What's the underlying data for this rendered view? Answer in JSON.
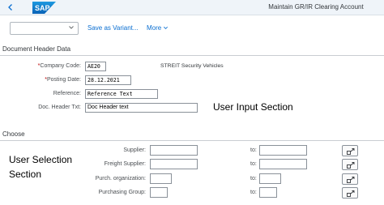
{
  "shell": {
    "logo_text": "SAP",
    "app_title": "Maintain GR/IR Clearing Account",
    "back_icon": "back-icon"
  },
  "toolbar": {
    "variant_value": "",
    "save_variant_label": "Save as Variant...",
    "more_label": "More"
  },
  "document_header": {
    "title": "Document Header Data",
    "company_code": {
      "label": "Company Code:",
      "value": "AE20",
      "description": "STREIT Security Vehicles"
    },
    "posting_date": {
      "label": "Posting Date:",
      "value": "28.12.2021"
    },
    "reference": {
      "label": "Reference:",
      "value": "Reference Text"
    },
    "doc_header_txt": {
      "label": "Doc. Header Txt:",
      "value": "Doc Header text"
    },
    "annotation": "User Input Section"
  },
  "choose": {
    "title": "Choose",
    "annotation_line1": "User Selection",
    "annotation_line2": "Section",
    "to_label": "to:",
    "rows": [
      {
        "label": "Supplier:",
        "from": "",
        "to": ""
      },
      {
        "label": "Freight Supplier:",
        "from": "",
        "to": ""
      },
      {
        "label": "Purch. organization:",
        "from": "",
        "to": ""
      },
      {
        "label": "Purchasing Group:",
        "from": "",
        "to": ""
      }
    ],
    "multi_select_icon": "multiple-selection-icon"
  },
  "colors": {
    "shell_bg": "#eff4f9",
    "link": "#0a6ed1",
    "logo_blue": "#0a74c9",
    "required": "#bb0000"
  }
}
